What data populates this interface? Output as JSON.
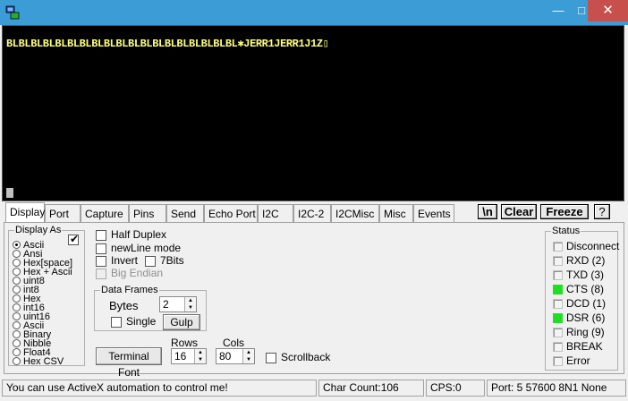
{
  "window": {
    "minimize": "—",
    "maximize": "□",
    "close": "✕"
  },
  "terminal": {
    "text": "BLBLBLBLBLBLBLBLBLBLBLBLBLBLBLBLBLBLBL✱JERR1JERR1J1Z▯"
  },
  "tabs": [
    "Display",
    "Port",
    "Capture",
    "Pins",
    "Send",
    "Echo Port",
    "I2C",
    "I2C-2",
    "I2CMisc",
    "Misc",
    "Events"
  ],
  "active_tab": "Display",
  "toolbar": {
    "newline": "\\n",
    "clear": "Clear",
    "freeze": "Freeze",
    "help": "?"
  },
  "display_as": {
    "legend": "Display As",
    "options": [
      "Ascii",
      "Ansi",
      "Hex[space]",
      "Hex + Ascii",
      "uint8",
      "int8",
      "Hex",
      "int16",
      "uint16",
      "Ascii",
      "Binary",
      "Nibble",
      "Float4",
      "Hex CSV"
    ],
    "selected_index": 0,
    "checkbox_checked": true
  },
  "options": {
    "half_duplex": {
      "label": "Half Duplex",
      "checked": false
    },
    "newline_mode": {
      "label": "newLine mode",
      "checked": false
    },
    "invert": {
      "label": "Invert",
      "checked": false
    },
    "seven_bits": {
      "label": "7Bits",
      "checked": false
    },
    "big_endian": {
      "label": "Big Endian",
      "checked": false
    }
  },
  "data_frames": {
    "legend": "Data Frames",
    "bytes_label": "Bytes",
    "bytes_value": "2",
    "single_label": "Single",
    "gulp_label": "Gulp"
  },
  "terminal_font_label": "Terminal Font",
  "rows": {
    "label": "Rows",
    "value": "16"
  },
  "cols": {
    "label": "Cols",
    "value": "80"
  },
  "scrollback_label": "Scrollback",
  "status": {
    "legend": "Status",
    "items": [
      {
        "label": "Disconnect",
        "on": false
      },
      {
        "label": "RXD (2)",
        "on": false
      },
      {
        "label": "TXD (3)",
        "on": false
      },
      {
        "label": "CTS (8)",
        "on": true
      },
      {
        "label": "DCD (1)",
        "on": false
      },
      {
        "label": "DSR (6)",
        "on": true
      },
      {
        "label": "Ring (9)",
        "on": false
      },
      {
        "label": "BREAK",
        "on": false
      },
      {
        "label": "Error",
        "on": false
      }
    ],
    "on_color": "#22dd22"
  },
  "statusbar": {
    "message": "You can use ActiveX automation to control me!",
    "char_count": "Char Count:106",
    "cps": "CPS:0",
    "port": "Port: 5  57600 8N1 None"
  }
}
